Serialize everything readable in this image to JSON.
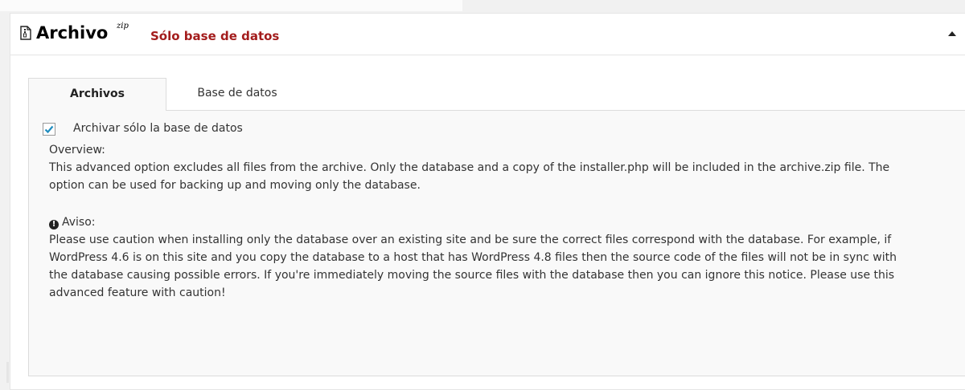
{
  "header": {
    "title": "Archivo",
    "badge": "zip",
    "status": "Sólo base de datos",
    "icon": "archive-file-icon",
    "collapse_icon": "collapse-up-arrow-icon"
  },
  "tabs": [
    {
      "label": "Archivos",
      "active": true
    },
    {
      "label": "Base de datos",
      "active": false
    }
  ],
  "archivos_tab": {
    "checkbox": {
      "label": "Archivar sólo la base de datos",
      "checked": true
    },
    "overview_title": "Overview:",
    "overview_body": "This advanced option excludes all files from the archive. Only the database and a copy of the installer.php will be included in the archive.zip file. The option can be used for backing up and moving only the database.",
    "warning_icon": "info-circle-icon",
    "warning_title": "Aviso:",
    "warning_body": "Please use caution when installing only the database over an existing site and be sure the correct files correspond with the database. For example, if WordPress 4.6 is on this site and you copy the database to a host that has WordPress 4.8 files then the source code of the files will not be in sync with the database causing possible errors. If you're immediately moving the source files with the database then you can ignore this notice. Please use this advanced feature with caution!"
  },
  "colors": {
    "status_red": "#a31c1c",
    "checkbox_blue": "#1e8cbe",
    "panel_bg": "#ffffff",
    "tab_bg": "#f9f9f9"
  }
}
